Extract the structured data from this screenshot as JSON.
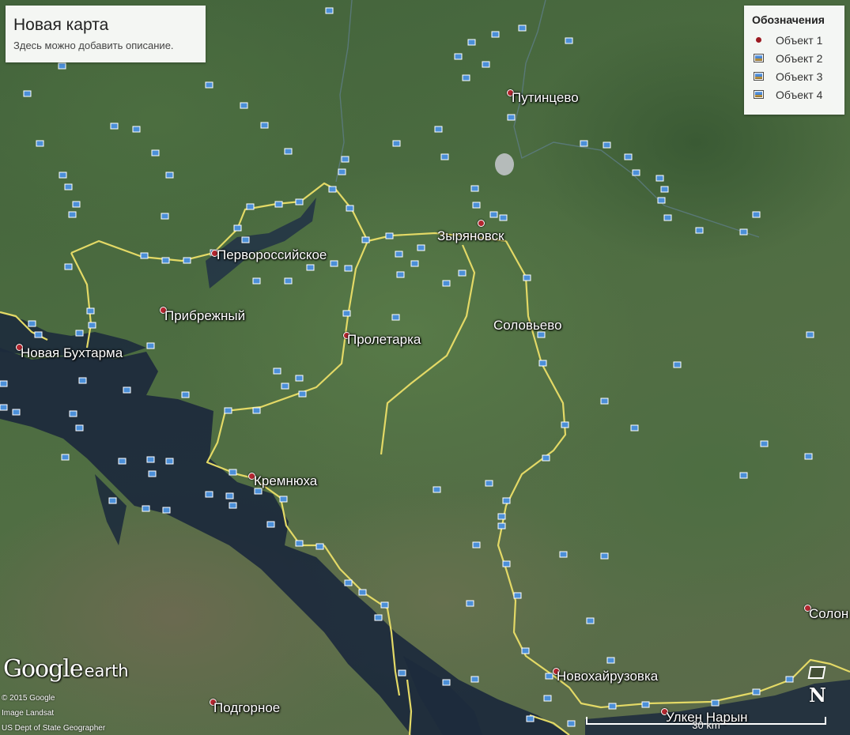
{
  "map": {
    "title": "Новая карта",
    "description": "Здесь можно добавить описание.",
    "legend": {
      "title": "Обозначения",
      "items": [
        {
          "label": "Объект 1",
          "icon": "red-dot-icon"
        },
        {
          "label": "Объект 2",
          "icon": "photo-marker-icon"
        },
        {
          "label": "Объект 3",
          "icon": "photo-marker-icon"
        },
        {
          "label": "Объект 4",
          "icon": "photo-marker-icon"
        }
      ]
    },
    "places": [
      "Путинцево",
      "Зыряновск",
      "Первороссийское",
      "Прибрежный",
      "Новая Бухтарма",
      "Пролетарка",
      "Соловьево",
      "Кремнюха",
      "Новохайрузовка",
      "Солон",
      "Подгорное",
      "Улкен Нарын"
    ],
    "branding": {
      "logo_google": "Google",
      "logo_earth": "earth",
      "credits": [
        "© 2015 Google",
        "Image Landsat",
        "US Dept of State Geographer"
      ]
    },
    "scale_label": "30 km",
    "north_label": "N",
    "colors": {
      "road": "#e8df6a",
      "water": "#1c2a3c",
      "place_marker": "#b3262f",
      "panel_bg": "#ffffff"
    }
  }
}
